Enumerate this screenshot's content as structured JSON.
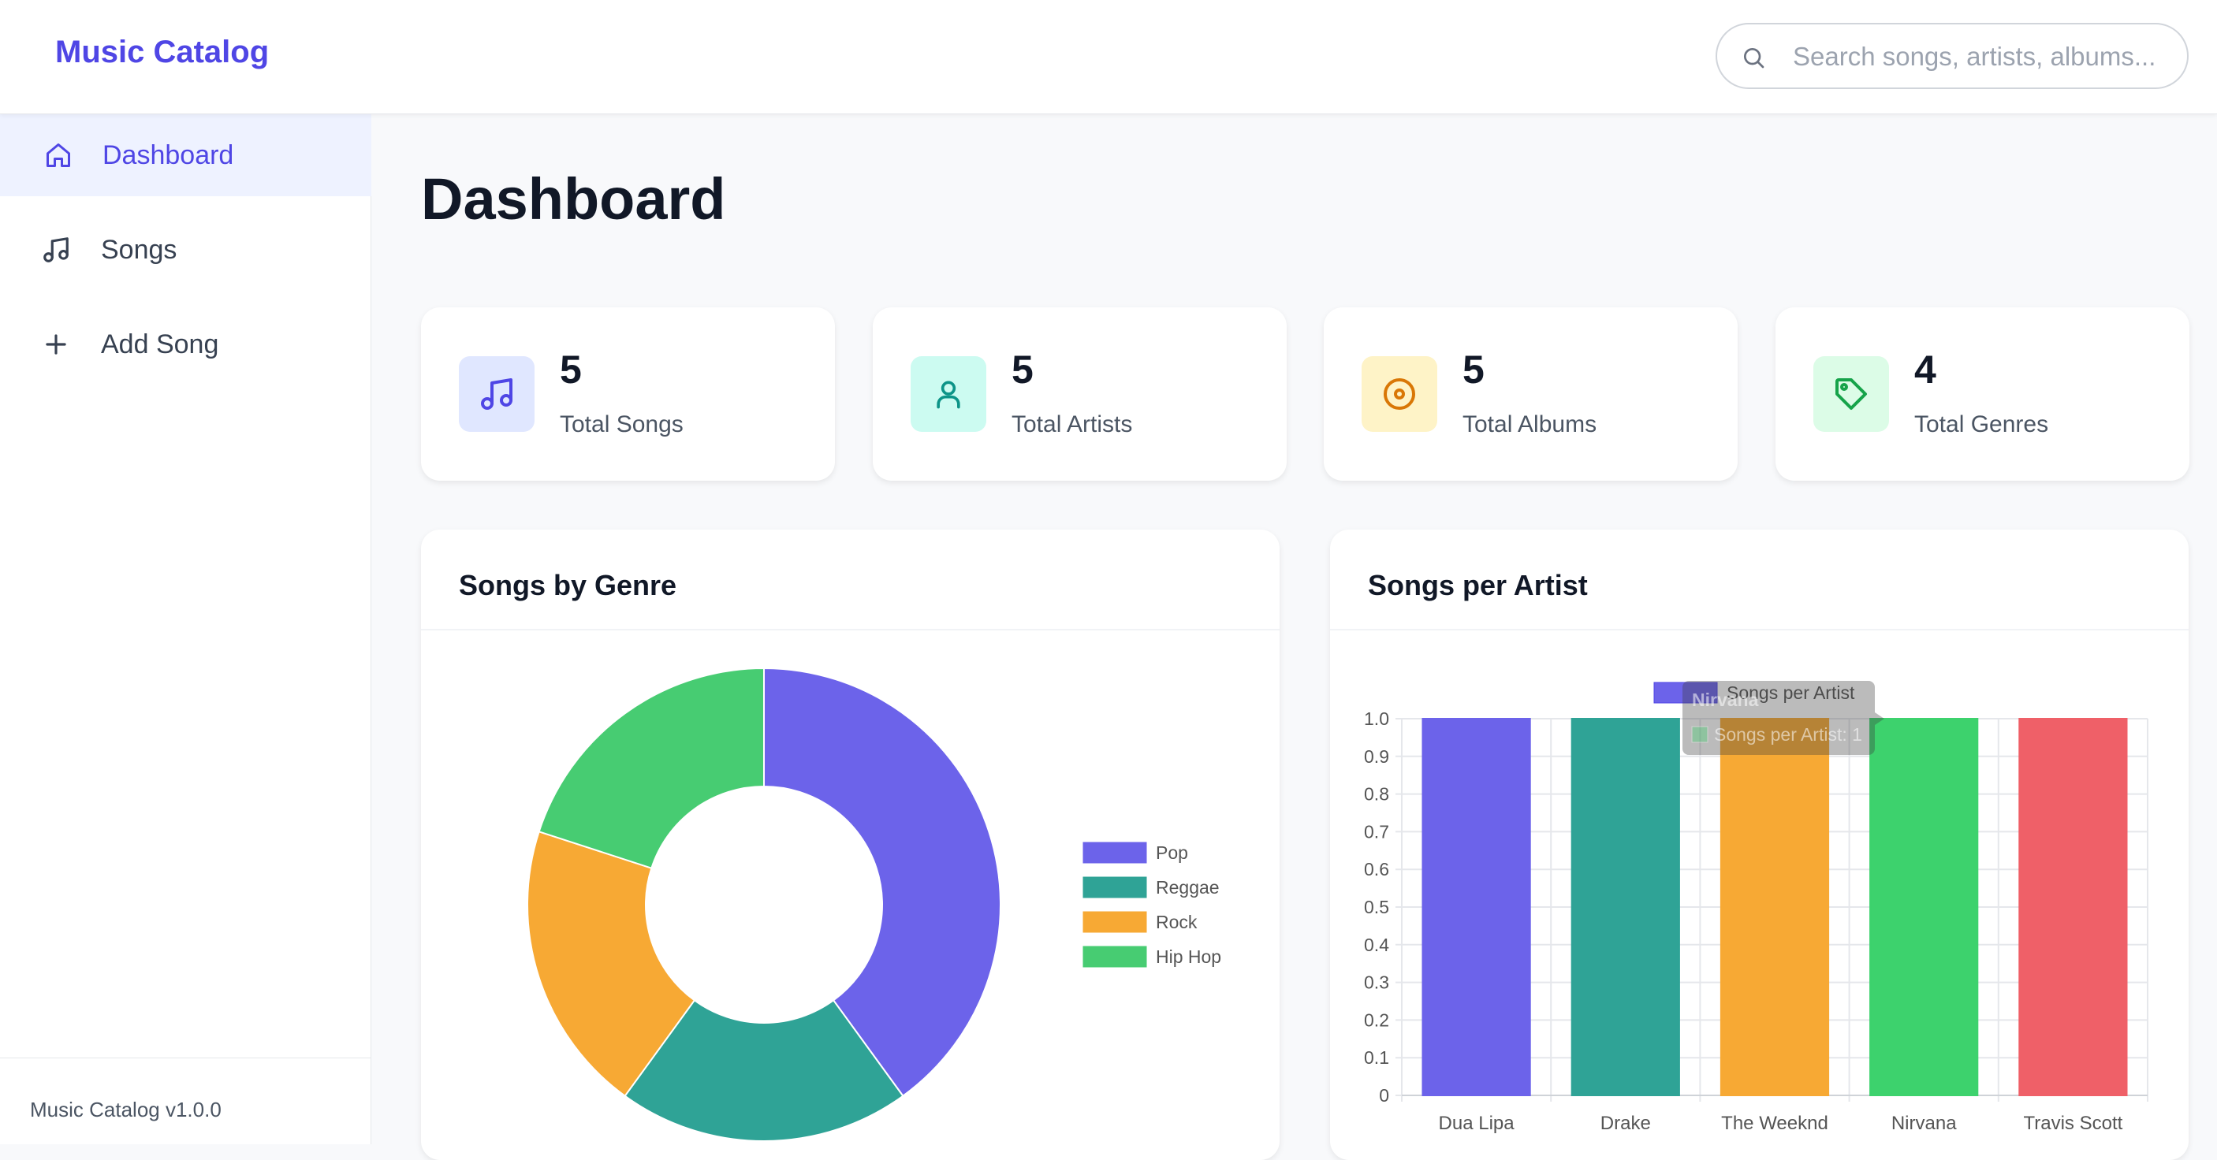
{
  "header": {
    "brand": "Music Catalog",
    "search_placeholder": "Search songs, artists, albums..."
  },
  "sidebar": {
    "items": [
      {
        "label": "Dashboard",
        "icon": "home-icon",
        "active": true
      },
      {
        "label": "Songs",
        "icon": "music-note-icon",
        "active": false
      },
      {
        "label": "Add Song",
        "icon": "plus-icon",
        "active": false
      }
    ],
    "footer": "Music Catalog v1.0.0"
  },
  "page": {
    "title": "Dashboard"
  },
  "stats": [
    {
      "value": "5",
      "label": "Total Songs",
      "icon": "music-note-icon",
      "bg": "#e0e7ff",
      "color": "#4f46e5"
    },
    {
      "value": "5",
      "label": "Total Artists",
      "icon": "user-icon",
      "bg": "#ccfbf1",
      "color": "#0d9488"
    },
    {
      "value": "5",
      "label": "Total Albums",
      "icon": "disc-icon",
      "bg": "#fef3c7",
      "color": "#d97706"
    },
    {
      "value": "4",
      "label": "Total Genres",
      "icon": "tag-icon",
      "bg": "#dcfce7",
      "color": "#16a34a"
    }
  ],
  "panels": {
    "genre_title": "Songs by Genre",
    "artist_title": "Songs per Artist"
  },
  "chart_data": [
    {
      "type": "pie",
      "title": "Songs by Genre",
      "categories": [
        "Pop",
        "Reggae",
        "Rock",
        "Hip Hop"
      ],
      "values": [
        2,
        1,
        1,
        1
      ],
      "colors": [
        "#6c63ea",
        "#2fa396",
        "#f7a934",
        "#47cc72"
      ],
      "legend": "right"
    },
    {
      "type": "bar",
      "title": "Songs per Artist",
      "series": [
        {
          "name": "Songs per Artist",
          "values": [
            1,
            1,
            1,
            1,
            1
          ]
        }
      ],
      "categories": [
        "Dua Lipa",
        "Drake",
        "The Weeknd",
        "Nirvana",
        "Travis Scott"
      ],
      "colors": [
        "#6c63ea",
        "#2fa396",
        "#f7a934",
        "#3dd26d",
        "#ef6068"
      ],
      "ylim": [
        0,
        1.0
      ],
      "yticks": [
        "0",
        "0.1",
        "0.2",
        "0.3",
        "0.4",
        "0.5",
        "0.6",
        "0.7",
        "0.8",
        "0.9",
        "1.0"
      ],
      "grid": true,
      "legend": "top",
      "tooltip": {
        "title": "Nirvana",
        "body": "Songs per Artist: 1"
      }
    }
  ]
}
